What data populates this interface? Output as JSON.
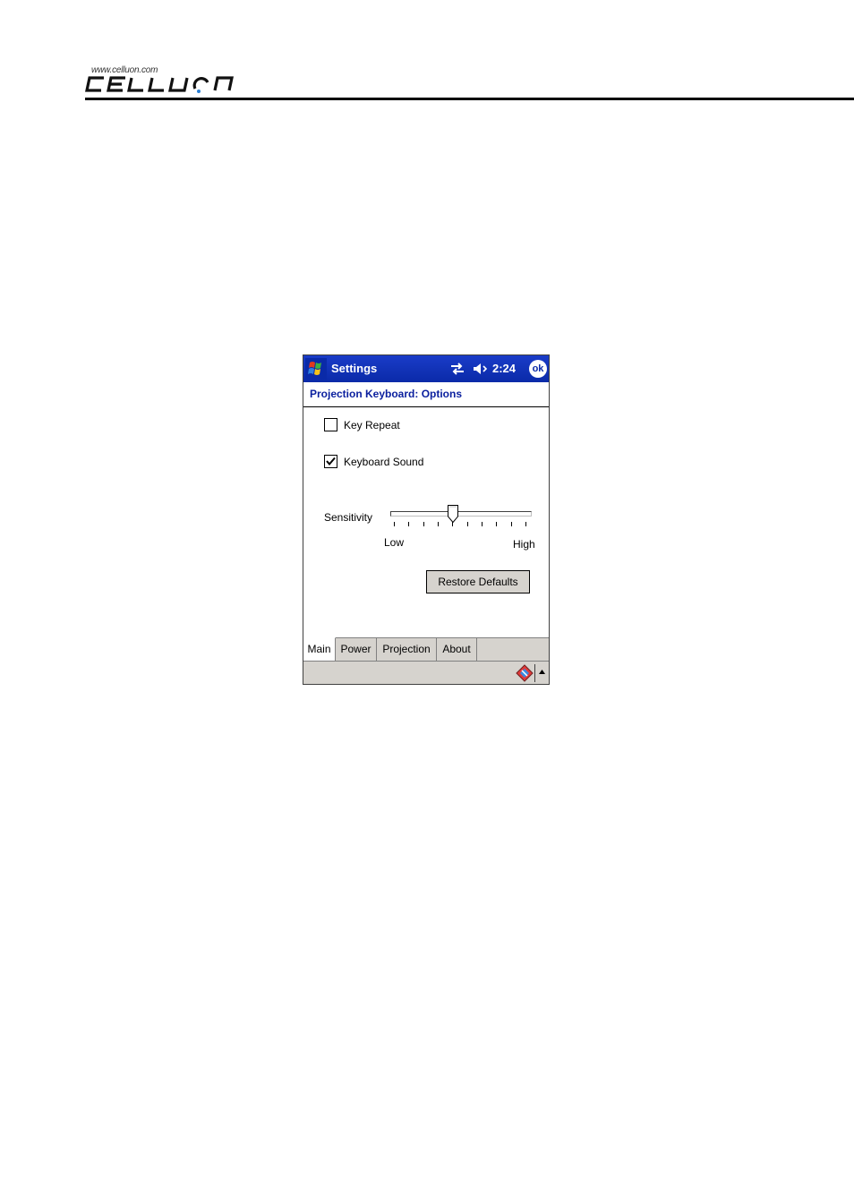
{
  "document": {
    "logo_url_text": "www.celluon.com",
    "logo_text": "CELLUON"
  },
  "device": {
    "titlebar": {
      "start_icon": "windows-flag-icon",
      "app_title": "Settings",
      "connectivity_icon": "connectivity-icon",
      "volume_icon": "speaker-muted-icon",
      "time": "2:24",
      "ok_label": "ok"
    },
    "page_heading": "Projection Keyboard: Options",
    "options": {
      "key_repeat_label": "Key Repeat",
      "key_repeat_checked": false,
      "keyboard_sound_label": "Keyboard Sound",
      "keyboard_sound_checked": true
    },
    "sensitivity": {
      "label": "Sensitivity",
      "low_label": "Low",
      "high_label": "High",
      "tick_count": 10,
      "selected_tick": 5
    },
    "restore_button_label": "Restore Defaults",
    "tabs": [
      {
        "label": "Main",
        "active": true
      },
      {
        "label": "Power",
        "active": false
      },
      {
        "label": "Projection",
        "active": false
      },
      {
        "label": "About",
        "active": false
      }
    ],
    "menubar": {
      "input_icon": "input-panel-icon",
      "arrow_icon": "up-arrow-icon"
    }
  },
  "colors": {
    "titlebar": "#0a2aa8",
    "heading_text": "#0a1f9e",
    "chrome_gray": "#d6d3ce"
  }
}
